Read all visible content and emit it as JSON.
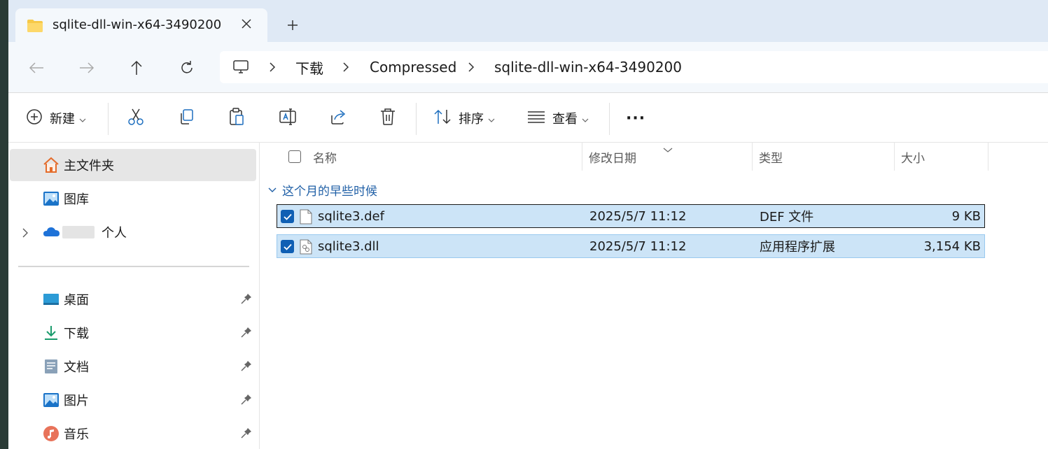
{
  "tab": {
    "title": "sqlite-dll-win-x64-3490200"
  },
  "breadcrumb": [
    "下载",
    "Compressed",
    "sqlite-dll-win-x64-3490200"
  ],
  "toolbar": {
    "new_label": "新建",
    "sort_label": "排序",
    "view_label": "查看",
    "more_label": "···"
  },
  "sidebar": {
    "items": [
      {
        "label": "主文件夹",
        "icon": "home-icon"
      },
      {
        "label": "图库",
        "icon": "gallery-icon"
      },
      {
        "label": "个人",
        "icon": "onedrive-icon"
      }
    ],
    "pinned": [
      {
        "label": "桌面",
        "icon": "desktop-icon"
      },
      {
        "label": "下载",
        "icon": "download-icon"
      },
      {
        "label": "文档",
        "icon": "documents-icon"
      },
      {
        "label": "图片",
        "icon": "pictures-icon"
      },
      {
        "label": "音乐",
        "icon": "music-icon"
      }
    ]
  },
  "columns": {
    "name": "名称",
    "date": "修改日期",
    "type": "类型",
    "size": "大小"
  },
  "group_label": "这个月的早些时候",
  "files": [
    {
      "name": "sqlite3.def",
      "date": "2025/5/7 11:12",
      "type": "DEF 文件",
      "size": "9 KB"
    },
    {
      "name": "sqlite3.dll",
      "date": "2025/5/7 11:12",
      "type": "应用程序扩展",
      "size": "3,154 KB"
    }
  ],
  "colors": {
    "selection": "#cce4f7",
    "accent": "#0f5fb4",
    "group": "#1f5fa6"
  }
}
